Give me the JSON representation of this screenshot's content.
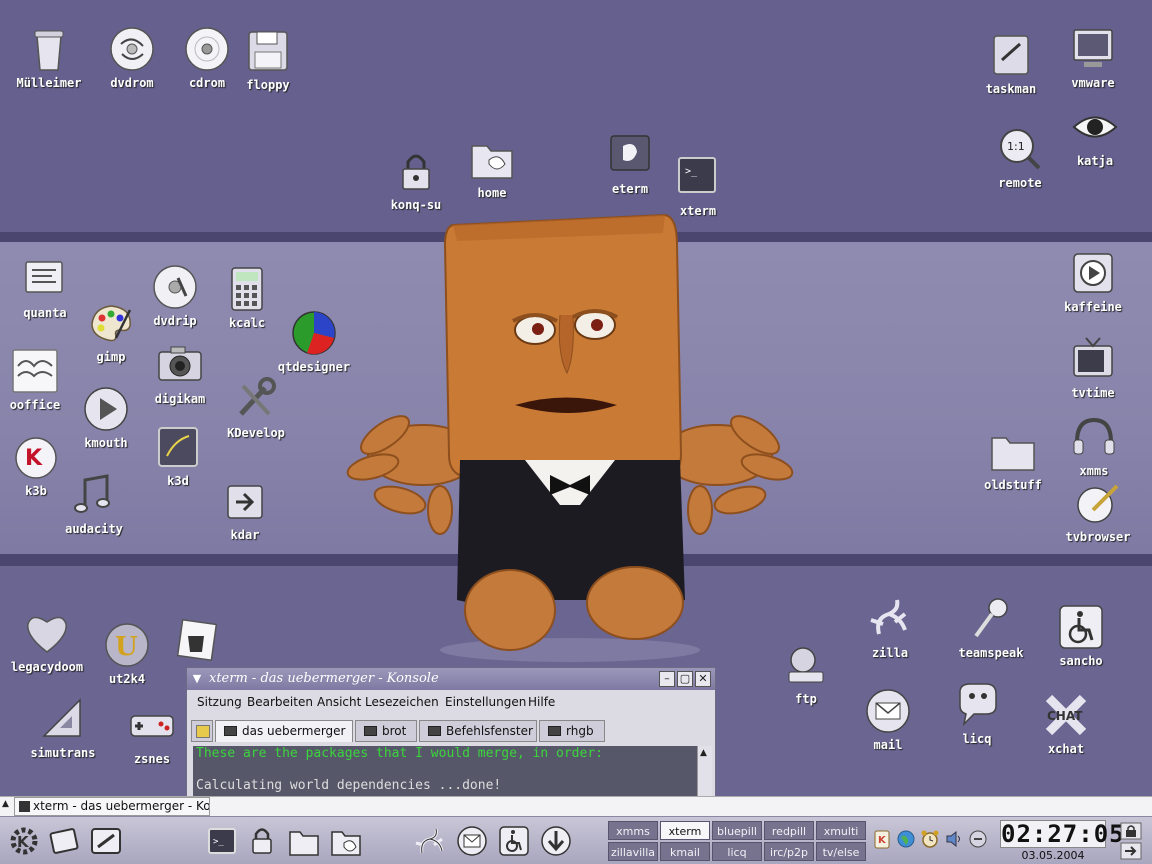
{
  "desktop": {
    "icons": [
      {
        "label": "Mülleimer",
        "icon": "trash-icon"
      },
      {
        "label": "dvdrom",
        "icon": "dvd-icon"
      },
      {
        "label": "cdrom",
        "icon": "cdrom-icon"
      },
      {
        "label": "floppy",
        "icon": "floppy-icon"
      },
      {
        "label": "konq-su",
        "icon": "lock-icon"
      },
      {
        "label": "home",
        "icon": "home-folder-icon"
      },
      {
        "label": "eterm",
        "icon": "eterm-icon"
      },
      {
        "label": "xterm",
        "icon": "terminal-icon"
      },
      {
        "label": "taskman",
        "icon": "taskman-icon"
      },
      {
        "label": "vmware",
        "icon": "vmware-icon"
      },
      {
        "label": "remote",
        "icon": "remote-icon"
      },
      {
        "label": "katja",
        "icon": "eye-icon"
      },
      {
        "label": "quanta",
        "icon": "quanta-icon"
      },
      {
        "label": "dvdrip",
        "icon": "dvdrip-icon"
      },
      {
        "label": "kcalc",
        "icon": "calculator-icon"
      },
      {
        "label": "gimp",
        "icon": "palette-icon"
      },
      {
        "label": "qtdesigner",
        "icon": "qtdesigner-icon"
      },
      {
        "label": "ooffice",
        "icon": "office-icon"
      },
      {
        "label": "digikam",
        "icon": "camera-icon"
      },
      {
        "label": "kmouth",
        "icon": "play-icon"
      },
      {
        "label": "KDevelop",
        "icon": "wrench-icon"
      },
      {
        "label": "k3b",
        "icon": "k3b-icon"
      },
      {
        "label": "k3d",
        "icon": "k3d-icon"
      },
      {
        "label": "audacity",
        "icon": "music-note-icon"
      },
      {
        "label": "kdar",
        "icon": "kdar-icon"
      },
      {
        "label": "kaffeine",
        "icon": "kaffeine-icon"
      },
      {
        "label": "tvtime",
        "icon": "tv-icon"
      },
      {
        "label": "oldstuff",
        "icon": "folder-icon"
      },
      {
        "label": "xmms",
        "icon": "headphones-icon"
      },
      {
        "label": "tvbrowser",
        "icon": "tvbrowser-icon"
      },
      {
        "label": "legacydoom",
        "icon": "heart-icon"
      },
      {
        "label": "ut2k4",
        "icon": "ut2k4-icon"
      },
      {
        "label": "simutrans",
        "icon": "ruler-icon"
      },
      {
        "label": "zsnes",
        "icon": "gamepad-icon"
      },
      {
        "label": "zilla",
        "icon": "gecko-icon"
      },
      {
        "label": "teamspeak",
        "icon": "microphone-icon"
      },
      {
        "label": "sancho",
        "icon": "wheelchair-icon"
      },
      {
        "label": "ftp",
        "icon": "ftp-icon"
      },
      {
        "label": "mail",
        "icon": "mail-icon"
      },
      {
        "label": "licq",
        "icon": "licq-icon"
      },
      {
        "label": "xchat",
        "icon": "xchat-icon"
      }
    ]
  },
  "konsole": {
    "title": "xterm - das uebermerger - Konsole",
    "menu": [
      "Sitzung",
      "Bearbeiten",
      "Ansicht",
      "Lesezeichen",
      "Einstellungen",
      "Hilfe"
    ],
    "tabs": [
      "das uebermerger",
      "brot",
      "Befehlsfenster",
      "rhgb"
    ],
    "active_tab": "das uebermerger",
    "lines": [
      "These are the packages that I would merge, in order:",
      "Calculating world dependencies ...done!"
    ]
  },
  "taskbar": {
    "task": "xterm - das uebermerger - Ko"
  },
  "pager": {
    "desktops": [
      "xmms",
      "xterm",
      "bluepill",
      "redpill",
      "xmulti",
      "zillavilla",
      "kmail",
      "licq",
      "irc/p2p",
      "tv/else"
    ],
    "active": "xterm"
  },
  "clock": {
    "time": "02:27:05",
    "date": "03.05.2004"
  },
  "colors": {
    "desktop_top": "#65608d",
    "desktop_mid": "#8783aa",
    "terminal_bg": "#56586a",
    "terminal_green": "#3cd43c"
  }
}
